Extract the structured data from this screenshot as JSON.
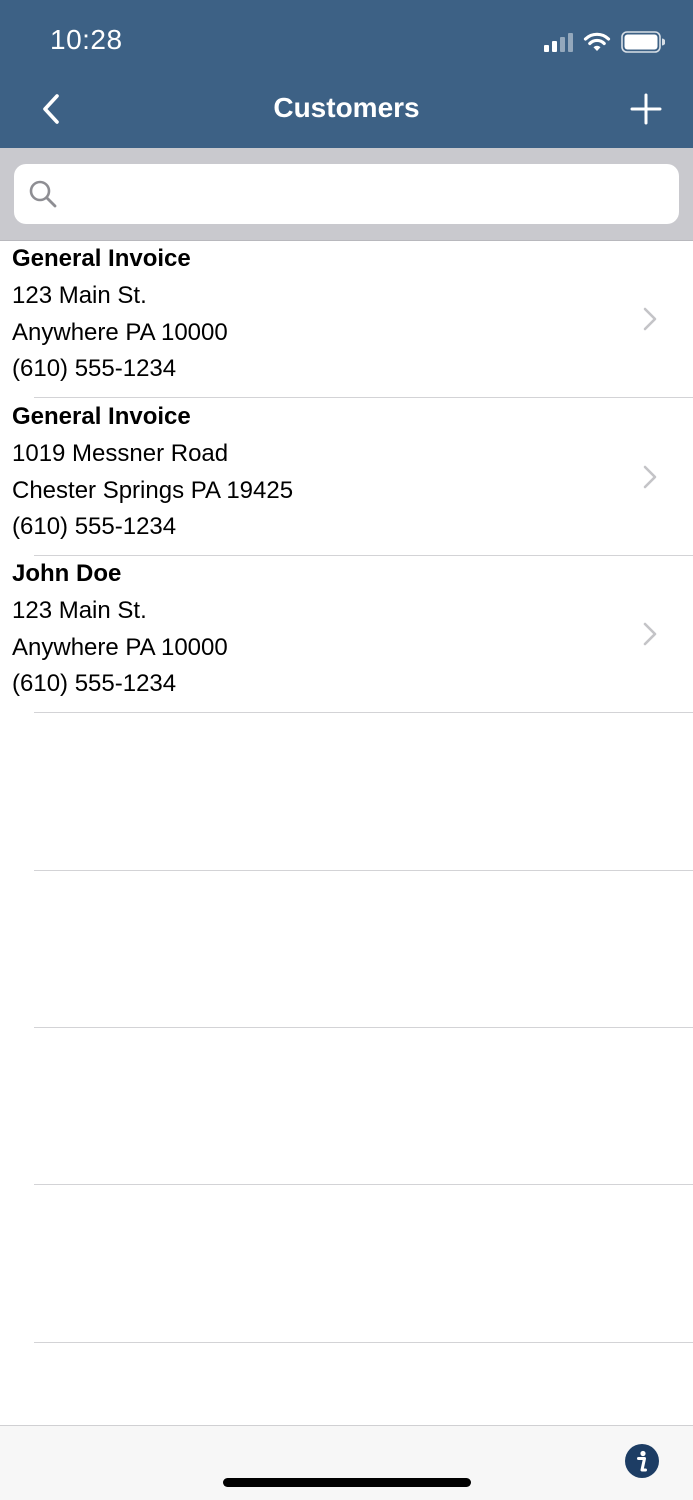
{
  "status_bar": {
    "time": "10:28",
    "icons": [
      "cellular-signal-icon",
      "wifi-icon",
      "battery-icon"
    ]
  },
  "nav": {
    "title": "Customers",
    "back_icon": "chevron-left-icon",
    "add_icon": "plus-icon"
  },
  "search": {
    "placeholder": "",
    "value": "",
    "icon": "search-icon"
  },
  "customers": [
    {
      "name": "General Invoice",
      "address_line1": "123 Main St.",
      "address_line2": "Anywhere PA 10000",
      "phone": "(610) 555-1234"
    },
    {
      "name": "General Invoice",
      "address_line1": "1019 Messner Road",
      "address_line2": "Chester Springs PA 19425",
      "phone": "(610) 555-1234"
    },
    {
      "name": "John Doe",
      "address_line1": "123 Main St.",
      "address_line2": "Anywhere PA 10000",
      "phone": "(610) 555-1234"
    }
  ],
  "footer": {
    "info_icon": "info-icon"
  },
  "colors": {
    "nav_background": "#3d6185",
    "search_background": "#c9c9ce",
    "separator": "#d3d3d6",
    "info_button": "#1d3d64"
  }
}
